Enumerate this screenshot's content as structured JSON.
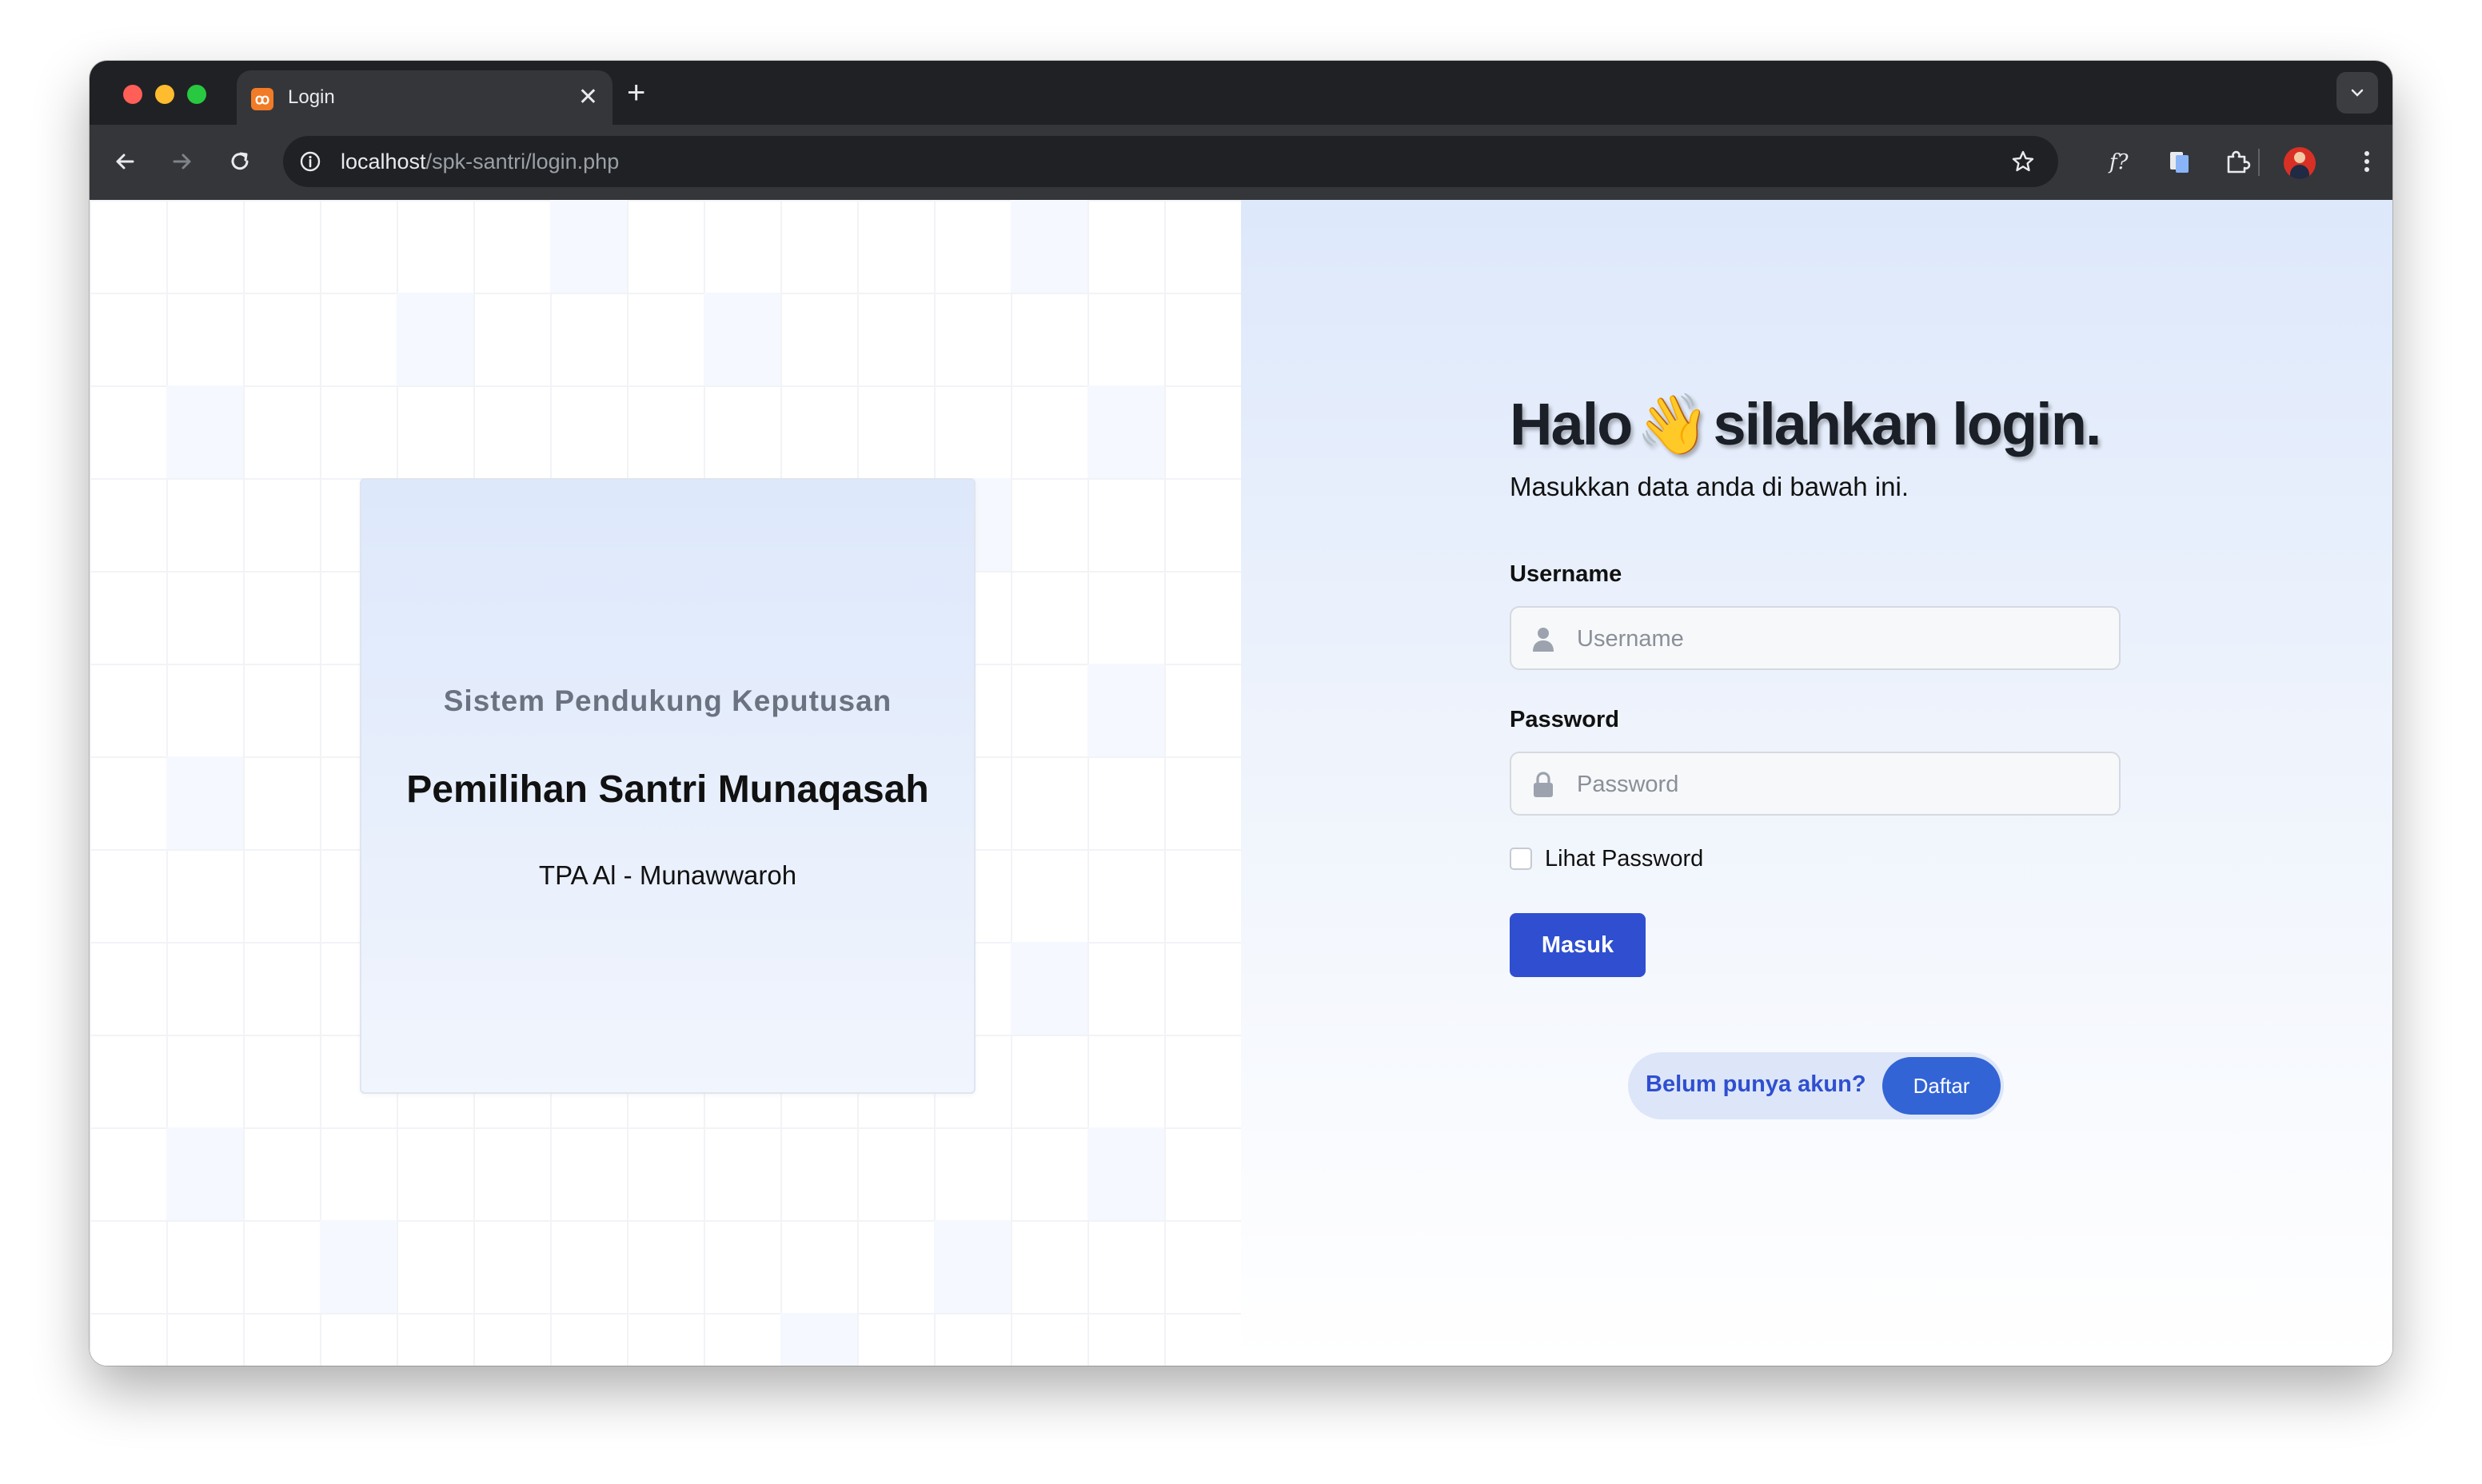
{
  "browser": {
    "tab_title": "Login",
    "tab_favicon": "xampp-icon",
    "url_host": "localhost",
    "url_path": "/spk-santri/login.php"
  },
  "hero_card": {
    "subtitle": "Sistem Pendukung Keputusan",
    "title": "Pemilihan Santri Munaqasah",
    "organization": "TPA Al - Munawwaroh"
  },
  "login": {
    "heading_before": "Halo",
    "heading_emoji": "👋",
    "heading_after": "silahkan login.",
    "subheading": "Masukkan data anda di bawah ini.",
    "username_label": "Username",
    "username_placeholder": "Username",
    "username_value": "",
    "password_label": "Password",
    "password_placeholder": "Password",
    "password_value": "",
    "show_password_label": "Lihat Password",
    "show_password_checked": false,
    "submit_label": "Masuk",
    "register_prompt": "Belum punya akun?",
    "register_label": "Daftar"
  },
  "colors": {
    "primary": "#2f4fd0",
    "register_button": "#3264d6",
    "browser_frame": "#202124"
  }
}
